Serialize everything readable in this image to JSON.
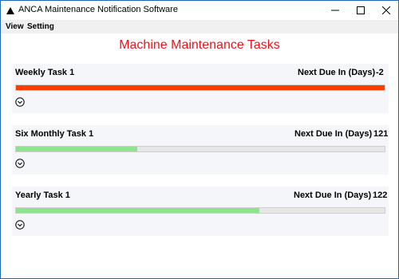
{
  "window": {
    "title": "ANCA Maintenance Notification Software",
    "icons": {
      "app": "app-logo-icon",
      "minimize": "minimize-icon",
      "maximize": "maximize-icon",
      "close": "close-icon"
    }
  },
  "menu": {
    "items": [
      "View",
      "Setting"
    ]
  },
  "page": {
    "title": "Machine Maintenance Tasks"
  },
  "colors": {
    "title": "#e8141c",
    "overdue": "#ff3c00",
    "ok": "#8fe38f",
    "track": "#e6e6e6"
  },
  "tasks": [
    {
      "name": "Weekly Task 1",
      "due_label": "Next Due In (Days)",
      "due_value": "-2",
      "progress": 1.0,
      "status": "overdue",
      "expand_icon": "chevron-down-circle-icon"
    },
    {
      "name": "Six Monthly Task 1",
      "due_label": "Next Due In (Days)",
      "due_value": "121",
      "progress": 0.33,
      "status": "ok",
      "expand_icon": "chevron-down-circle-icon"
    },
    {
      "name": "Yearly Task 1",
      "due_label": "Next Due In (Days)",
      "due_value": "122",
      "progress": 0.66,
      "status": "ok",
      "expand_icon": "chevron-down-circle-icon"
    }
  ]
}
